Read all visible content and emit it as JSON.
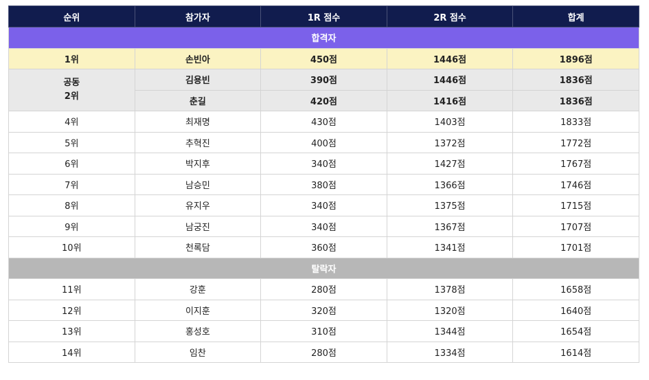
{
  "colors": {
    "header_bg": "#111c4e",
    "passed_bg": "#7b61ea",
    "eliminated_bg": "#b7b7b7",
    "first_place_bg": "#fbf3c2",
    "tie_bg": "#e9e9e9"
  },
  "table": {
    "headers": [
      "순위",
      "참가자",
      "1R 점수",
      "2R 점수",
      "합계"
    ],
    "sections": {
      "passed": "합격자",
      "eliminated": "탈락자"
    },
    "first": {
      "rank": "1위",
      "name": "손빈아",
      "r1": "450점",
      "r2": "1446점",
      "total": "1896점"
    },
    "tie": {
      "rank_line1": "공동",
      "rank_line2": "2위",
      "rows": [
        {
          "name": "김용빈",
          "r1": "390점",
          "r2": "1446점",
          "total": "1836점"
        },
        {
          "name": "춘길",
          "r1": "420점",
          "r2": "1416점",
          "total": "1836점"
        }
      ]
    },
    "passed_rows": [
      {
        "rank": "4위",
        "name": "최재명",
        "r1": "430점",
        "r2": "1403점",
        "total": "1833점"
      },
      {
        "rank": "5위",
        "name": "추혁진",
        "r1": "400점",
        "r2": "1372점",
        "total": "1772점"
      },
      {
        "rank": "6위",
        "name": "박지후",
        "r1": "340점",
        "r2": "1427점",
        "total": "1767점"
      },
      {
        "rank": "7위",
        "name": "남승민",
        "r1": "380점",
        "r2": "1366점",
        "total": "1746점"
      },
      {
        "rank": "8위",
        "name": "유지우",
        "r1": "340점",
        "r2": "1375점",
        "total": "1715점"
      },
      {
        "rank": "9위",
        "name": "남궁진",
        "r1": "340점",
        "r2": "1367점",
        "total": "1707점"
      },
      {
        "rank": "10위",
        "name": "천록담",
        "r1": "360점",
        "r2": "1341점",
        "total": "1701점"
      }
    ],
    "eliminated_rows": [
      {
        "rank": "11위",
        "name": "강훈",
        "r1": "280점",
        "r2": "1378점",
        "total": "1658점"
      },
      {
        "rank": "12위",
        "name": "이지훈",
        "r1": "320점",
        "r2": "1320점",
        "total": "1640점"
      },
      {
        "rank": "13위",
        "name": "홍성호",
        "r1": "310점",
        "r2": "1344점",
        "total": "1654점"
      },
      {
        "rank": "14위",
        "name": "임찬",
        "r1": "280점",
        "r2": "1334점",
        "total": "1614점"
      }
    ]
  }
}
